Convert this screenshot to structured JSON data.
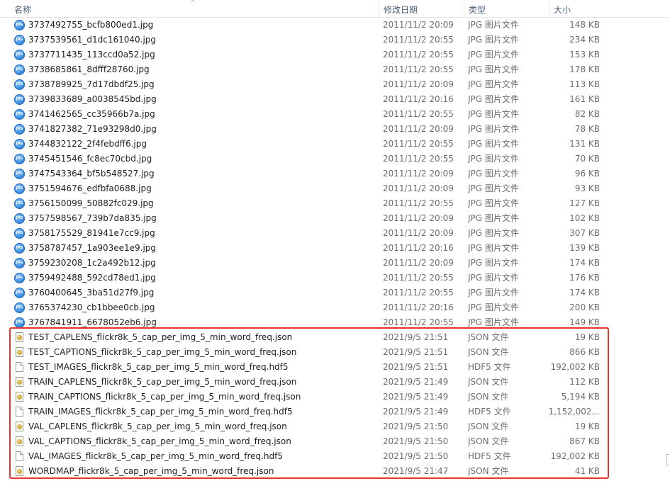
{
  "header": {
    "name": "名称",
    "date": "修改日期",
    "type": "类型",
    "size": "大小",
    "sort_indicator": "^"
  },
  "colors": {
    "highlight": "#e8342b",
    "header_text": "#4c607a",
    "meta_text": "#6d6d6d"
  },
  "files": [
    {
      "name": "3737492755_bcfb800ed1.jpg",
      "date": "2011/11/2 20:09",
      "type": "JPG 图片文件",
      "size": "148 KB",
      "icon": "jpg-file-icon"
    },
    {
      "name": "3737539561_d1dc161040.jpg",
      "date": "2011/11/2 20:55",
      "type": "JPG 图片文件",
      "size": "234 KB",
      "icon": "jpg-file-icon"
    },
    {
      "name": "3737711435_113ccd0a52.jpg",
      "date": "2011/11/2 20:55",
      "type": "JPG 图片文件",
      "size": "153 KB",
      "icon": "jpg-file-icon"
    },
    {
      "name": "3738685861_8dfff28760.jpg",
      "date": "2011/11/2 20:55",
      "type": "JPG 图片文件",
      "size": "178 KB",
      "icon": "jpg-file-icon"
    },
    {
      "name": "3738789925_7d17dbdf25.jpg",
      "date": "2011/11/2 20:09",
      "type": "JPG 图片文件",
      "size": "113 KB",
      "icon": "jpg-file-icon"
    },
    {
      "name": "3739833689_a0038545bd.jpg",
      "date": "2011/11/2 20:16",
      "type": "JPG 图片文件",
      "size": "161 KB",
      "icon": "jpg-file-icon"
    },
    {
      "name": "3741462565_cc35966b7a.jpg",
      "date": "2011/11/2 20:55",
      "type": "JPG 图片文件",
      "size": "82 KB",
      "icon": "jpg-file-icon"
    },
    {
      "name": "3741827382_71e93298d0.jpg",
      "date": "2011/11/2 20:09",
      "type": "JPG 图片文件",
      "size": "78 KB",
      "icon": "jpg-file-icon"
    },
    {
      "name": "3744832122_2f4febdff6.jpg",
      "date": "2011/11/2 20:55",
      "type": "JPG 图片文件",
      "size": "131 KB",
      "icon": "jpg-file-icon"
    },
    {
      "name": "3745451546_fc8ec70cbd.jpg",
      "date": "2011/11/2 20:55",
      "type": "JPG 图片文件",
      "size": "70 KB",
      "icon": "jpg-file-icon"
    },
    {
      "name": "3747543364_bf5b548527.jpg",
      "date": "2011/11/2 20:09",
      "type": "JPG 图片文件",
      "size": "96 KB",
      "icon": "jpg-file-icon"
    },
    {
      "name": "3751594676_edfbfa0688.jpg",
      "date": "2011/11/2 20:09",
      "type": "JPG 图片文件",
      "size": "93 KB",
      "icon": "jpg-file-icon"
    },
    {
      "name": "3756150099_50882fc029.jpg",
      "date": "2011/11/2 20:55",
      "type": "JPG 图片文件",
      "size": "127 KB",
      "icon": "jpg-file-icon"
    },
    {
      "name": "3757598567_739b7da835.jpg",
      "date": "2011/11/2 20:09",
      "type": "JPG 图片文件",
      "size": "102 KB",
      "icon": "jpg-file-icon"
    },
    {
      "name": "3758175529_81941e7cc9.jpg",
      "date": "2011/11/2 20:09",
      "type": "JPG 图片文件",
      "size": "307 KB",
      "icon": "jpg-file-icon"
    },
    {
      "name": "3758787457_1a903ee1e9.jpg",
      "date": "2011/11/2 20:16",
      "type": "JPG 图片文件",
      "size": "139 KB",
      "icon": "jpg-file-icon"
    },
    {
      "name": "3759230208_1c2a492b12.jpg",
      "date": "2011/11/2 20:09",
      "type": "JPG 图片文件",
      "size": "174 KB",
      "icon": "jpg-file-icon"
    },
    {
      "name": "3759492488_592cd78ed1.jpg",
      "date": "2011/11/2 20:55",
      "type": "JPG 图片文件",
      "size": "176 KB",
      "icon": "jpg-file-icon"
    },
    {
      "name": "3760400645_3ba51d27f9.jpg",
      "date": "2011/11/2 20:55",
      "type": "JPG 图片文件",
      "size": "174 KB",
      "icon": "jpg-file-icon"
    },
    {
      "name": "3765374230_cb1bbee0cb.jpg",
      "date": "2011/11/2 20:16",
      "type": "JPG 图片文件",
      "size": "200 KB",
      "icon": "jpg-file-icon"
    },
    {
      "name": "3767841911_6678052eb6.jpg",
      "date": "2011/11/2 20:55",
      "type": "JPG 图片文件",
      "size": "149 KB",
      "icon": "jpg-file-icon"
    },
    {
      "name": "TEST_CAPLENS_flickr8k_5_cap_per_img_5_min_word_freq.json",
      "date": "2021/9/5 21:51",
      "type": "JSON 文件",
      "size": "19 KB",
      "icon": "json-file-icon"
    },
    {
      "name": "TEST_CAPTIONS_flickr8k_5_cap_per_img_5_min_word_freq.json",
      "date": "2021/9/5 21:51",
      "type": "JSON 文件",
      "size": "866 KB",
      "icon": "json-file-icon"
    },
    {
      "name": "TEST_IMAGES_flickr8k_5_cap_per_img_5_min_word_freq.hdf5",
      "date": "2021/9/5 21:51",
      "type": "HDF5 文件",
      "size": "192,002 KB",
      "icon": "hdf5-file-icon"
    },
    {
      "name": "TRAIN_CAPLENS_flickr8k_5_cap_per_img_5_min_word_freq.json",
      "date": "2021/9/5 21:49",
      "type": "JSON 文件",
      "size": "112 KB",
      "icon": "json-file-icon"
    },
    {
      "name": "TRAIN_CAPTIONS_flickr8k_5_cap_per_img_5_min_word_freq.json",
      "date": "2021/9/5 21:49",
      "type": "JSON 文件",
      "size": "5,194 KB",
      "icon": "json-file-icon"
    },
    {
      "name": "TRAIN_IMAGES_flickr8k_5_cap_per_img_5_min_word_freq.hdf5",
      "date": "2021/9/5 21:49",
      "type": "HDF5 文件",
      "size": "1,152,002...",
      "icon": "hdf5-file-icon"
    },
    {
      "name": "VAL_CAPLENS_flickr8k_5_cap_per_img_5_min_word_freq.json",
      "date": "2021/9/5 21:50",
      "type": "JSON 文件",
      "size": "19 KB",
      "icon": "json-file-icon"
    },
    {
      "name": "VAL_CAPTIONS_flickr8k_5_cap_per_img_5_min_word_freq.json",
      "date": "2021/9/5 21:50",
      "type": "JSON 文件",
      "size": "867 KB",
      "icon": "json-file-icon"
    },
    {
      "name": "VAL_IMAGES_flickr8k_5_cap_per_img_5_min_word_freq.hdf5",
      "date": "2021/9/5 21:50",
      "type": "HDF5 文件",
      "size": "192,002 KB",
      "icon": "hdf5-file-icon"
    },
    {
      "name": "WORDMAP_flickr8k_5_cap_per_img_5_min_word_freq.json",
      "date": "2021/9/5 21:47",
      "type": "JSON 文件",
      "size": "41 KB",
      "icon": "json-file-icon"
    }
  ]
}
